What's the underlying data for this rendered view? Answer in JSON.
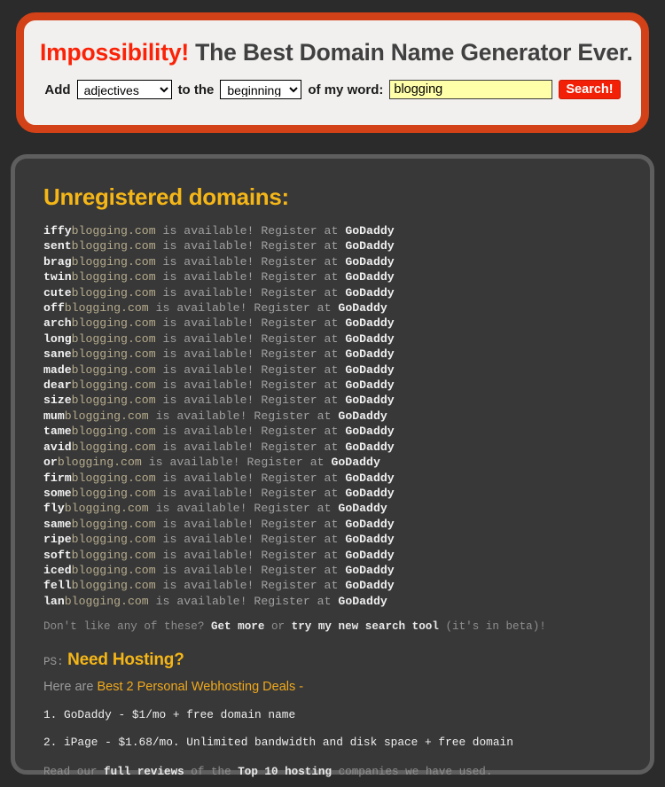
{
  "search_panel": {
    "headline_brand": "Impossibility!",
    "headline_rest": " The Best Domain Name Generator Ever.",
    "label_add": "Add",
    "label_to_the": "to the",
    "label_of_my_word": "of my word:",
    "word_type_selected": "adjectives",
    "word_type_options": [
      "adjectives"
    ],
    "position_selected": "beginning",
    "position_options": [
      "beginning"
    ],
    "word_value": "blogging",
    "word_placeholder": "",
    "search_button": "Search!",
    "border_color": "#d24117",
    "brand_color": "#fb2207",
    "input_bg": "#ffffaa",
    "button_bg": "#f22006"
  },
  "results": {
    "title": "Unregistered domains:",
    "title_color": "#f5b617",
    "root": "blogging.com",
    "available_text": " is available! Register at ",
    "registrar": "GoDaddy",
    "prefixes": [
      "iffy",
      "sent",
      "brag",
      "twin",
      "cute",
      "off",
      "arch",
      "long",
      "sane",
      "made",
      "dear",
      "size",
      "mum",
      "tame",
      "avid",
      "or",
      "firm",
      "some",
      "fly",
      "same",
      "ripe",
      "soft",
      "iced",
      "fell",
      "lan"
    ]
  },
  "footer": {
    "more_prefix": "Don't like any of these? ",
    "more_link": "Get more",
    "more_or": " or ",
    "more_link2": "try my new search tool",
    "more_suffix": " (it's in beta)!",
    "ps_label": "PS:",
    "ps_heading": "Need Hosting?",
    "here_grey": "Here are ",
    "here_gold": "Best 2 Personal Webhosting Deals -",
    "deal_1": "1. GoDaddy - $1/mo + free domain name",
    "deal_2": "2. iPage - $1.68/mo. Unlimited bandwidth and disk space + free domain",
    "read_prefix": "Read our ",
    "read_link": "full reviews",
    "read_mid": " of the ",
    "read_link2": "Top 10 hosting",
    "read_suffix": " companies we have used."
  }
}
